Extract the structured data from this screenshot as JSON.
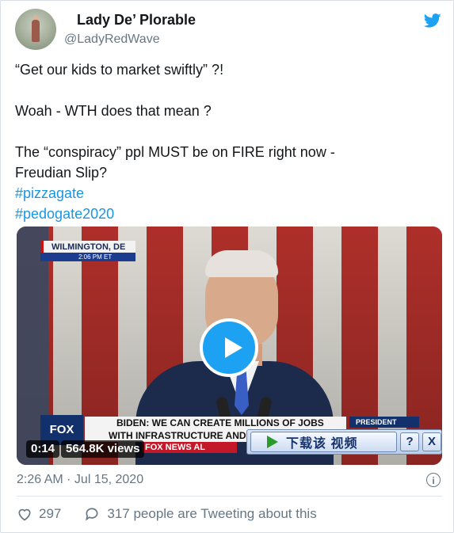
{
  "user": {
    "name": "Lady De’ Plorable",
    "handle": "@LadyRedWave"
  },
  "tweet": {
    "line1": "“Get our kids to market  swiftly” ?!",
    "line2": "Woah - WTH does that mean ?",
    "line3": "The  “conspiracy”  ppl MUST be on FIRE right now -",
    "line4": "Freudian Slip?",
    "hashtags": [
      "#pizzagate",
      "#pedogate2020"
    ]
  },
  "video": {
    "location": "WILMINGTON, DE",
    "time": "2:06 PM ET",
    "channel_logo": "FOX",
    "headline_top": "BIDEN: WE CAN CREATE MILLIONS OF JOBS",
    "headline_bottom": "WITH INFRASTRUCTURE AND A CLI",
    "network_tag": "FOX NEWS AL",
    "side_label": "PRESIDENT",
    "duration": "0:14",
    "views": "564.8K views",
    "download_label": "下载该 视频",
    "help_label": "?",
    "close_label": "X"
  },
  "meta": {
    "timestamp": "2:26 AM · Jul 15, 2020",
    "info_icon": "i"
  },
  "actions": {
    "likes": "297",
    "tweeting": "317 people are Tweeting about this"
  },
  "colors": {
    "link": "#1b95e0",
    "twitter_blue": "#1da1f2",
    "secondary": "#657786"
  }
}
